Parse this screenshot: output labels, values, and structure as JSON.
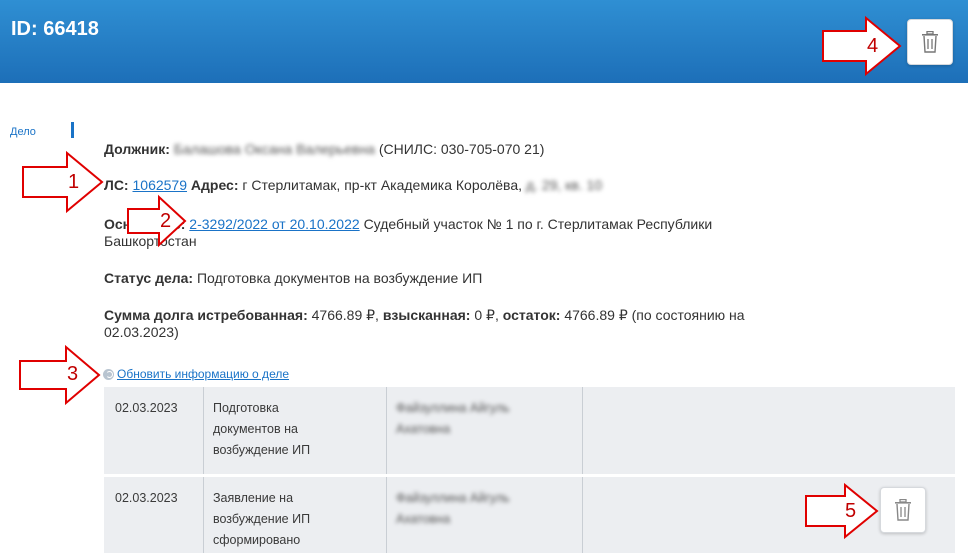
{
  "header": {
    "title": "ID: 66418",
    "delete_icon": "trash-icon"
  },
  "sidebar": {
    "tab_label": "Дело"
  },
  "case": {
    "debtor_label": "Должник:",
    "debtor_name": "Балашова Оксана Валерьевна",
    "debtor_snils": "(СНИЛС: 030-705-070 21)",
    "account_label": "ЛС:",
    "account_value": "1062579",
    "address_label": "Адрес:",
    "address_value": "г Стерлитамак, пр-кт Академика Королёва,",
    "address_hidden": "д. 29, кв. 10",
    "basis_label": "Основание:",
    "basis_link": "2-3292/2022 от 20.10.2022",
    "basis_text": "Судебный участок № 1 по г. Стерлитамак Республики",
    "basis_text2": "Башкортостан",
    "status_label": "Статус дела:",
    "status_value": "Подготовка документов на возбуждение ИП",
    "sum_label": "Сумма долга истребованная:",
    "sum_requested": "4766.89 ₽",
    "collected_label": "взысканная:",
    "collected_value": "0 ₽",
    "remain_label": "остаток:",
    "remain_value": "4766.89 ₽",
    "as_of": "(по состоянию на",
    "as_of2": "02.03.2023)"
  },
  "refresh": {
    "label": "Обновить информацию о деле",
    "icon": "refresh-icon"
  },
  "history": [
    {
      "date": "02.03.2023",
      "event": [
        "Подготовка",
        "документов на",
        "возбуждение ИП"
      ],
      "person": [
        "Файзуллина Айгуль",
        "Ахатовна"
      ]
    },
    {
      "date": "02.03.2023",
      "event": [
        "Заявление на",
        "возбуждение ИП",
        "сформировано"
      ],
      "person": [
        "Файзуллина Айгуль",
        "Ахатовна"
      ]
    }
  ],
  "annotations": {
    "n1": "1",
    "n2": "2",
    "n3": "3",
    "n4": "4",
    "n5": "5"
  },
  "colors": {
    "header": "#2080c8",
    "link": "#1a73c7",
    "annotation": "#e00000",
    "row_bg": "#eceef1"
  }
}
